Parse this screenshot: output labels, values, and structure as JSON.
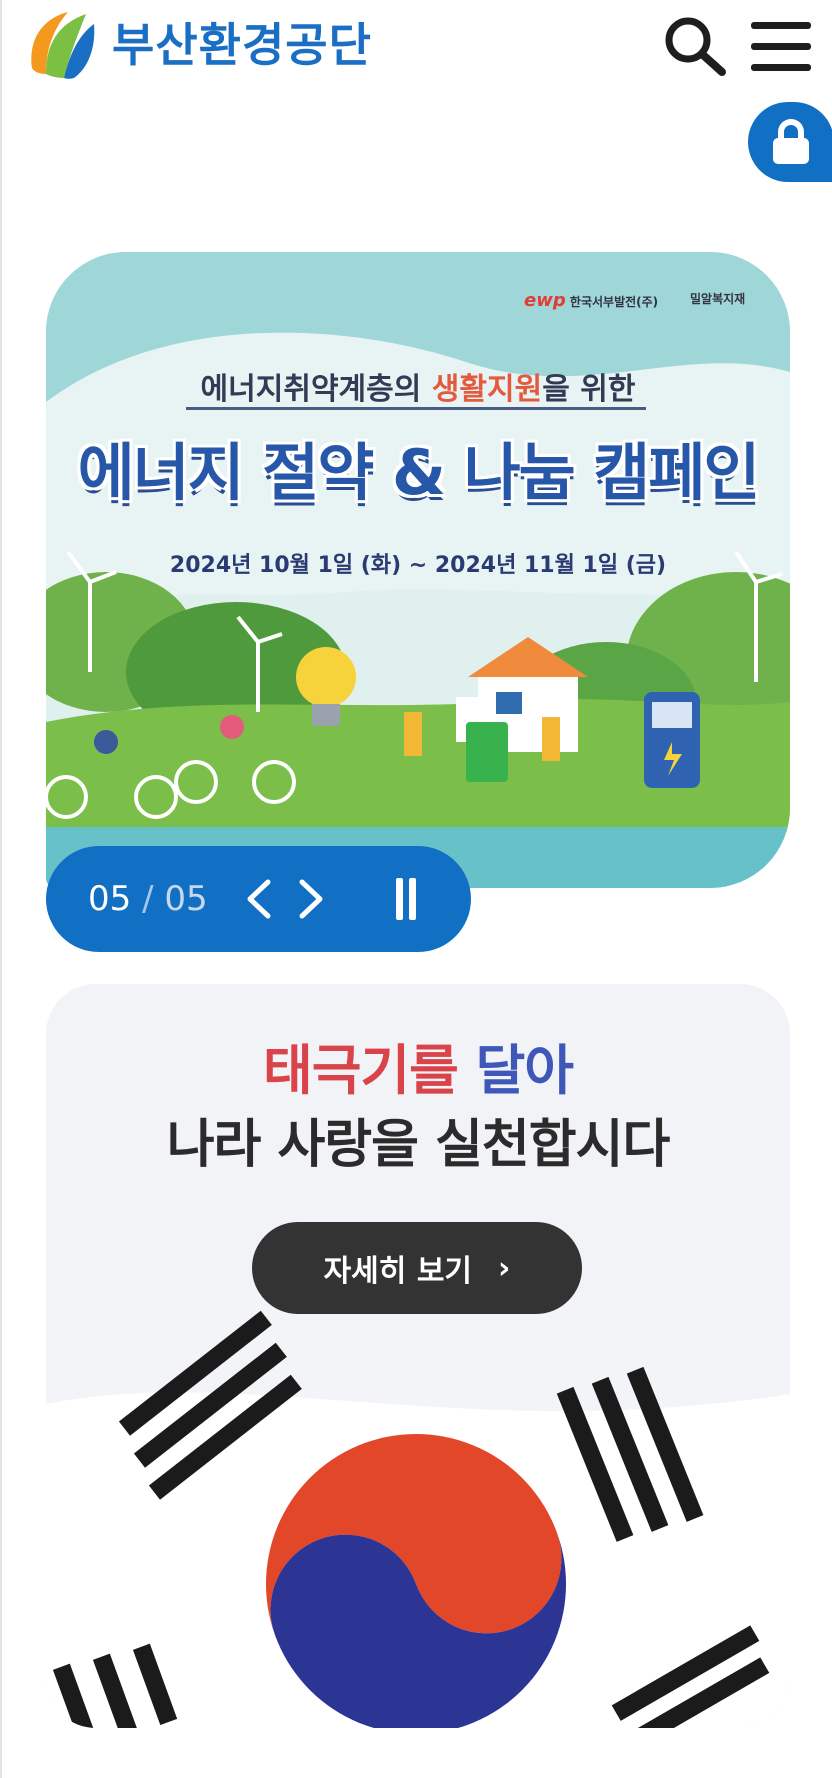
{
  "header": {
    "logo_text": "부산환경공단",
    "search_icon": "search-icon",
    "menu_icon": "hamburger-menu-icon",
    "lock_icon": "lock-icon"
  },
  "slides": {
    "current": {
      "sponsor1_mark": "ewp",
      "sponsor1": "한국서부발전(주)",
      "sponsor2": "밀알복지재",
      "subtitle_pre": "에너지취약계층의 ",
      "subtitle_hl": "생활지원",
      "subtitle_post": "을 위한",
      "title": "에너지 절약 & 나눔 캠페인",
      "date": "2024년 10월 1일 (화) ~ 2024년 11월 1일 (금)"
    },
    "pager": {
      "current": "05",
      "separator": " / ",
      "total": "05"
    }
  },
  "banner": {
    "title_red": "태극기를 ",
    "title_blue": "달아",
    "title_line2": "나라 사랑을 실천합시다",
    "button_label": "자세히 보기",
    "button_chevron": "›"
  },
  "colors": {
    "brand_blue": "#1170c4",
    "logo_text": "#1a6fc4",
    "banner_red": "#d9434a",
    "banner_blue": "#3f57b8"
  }
}
